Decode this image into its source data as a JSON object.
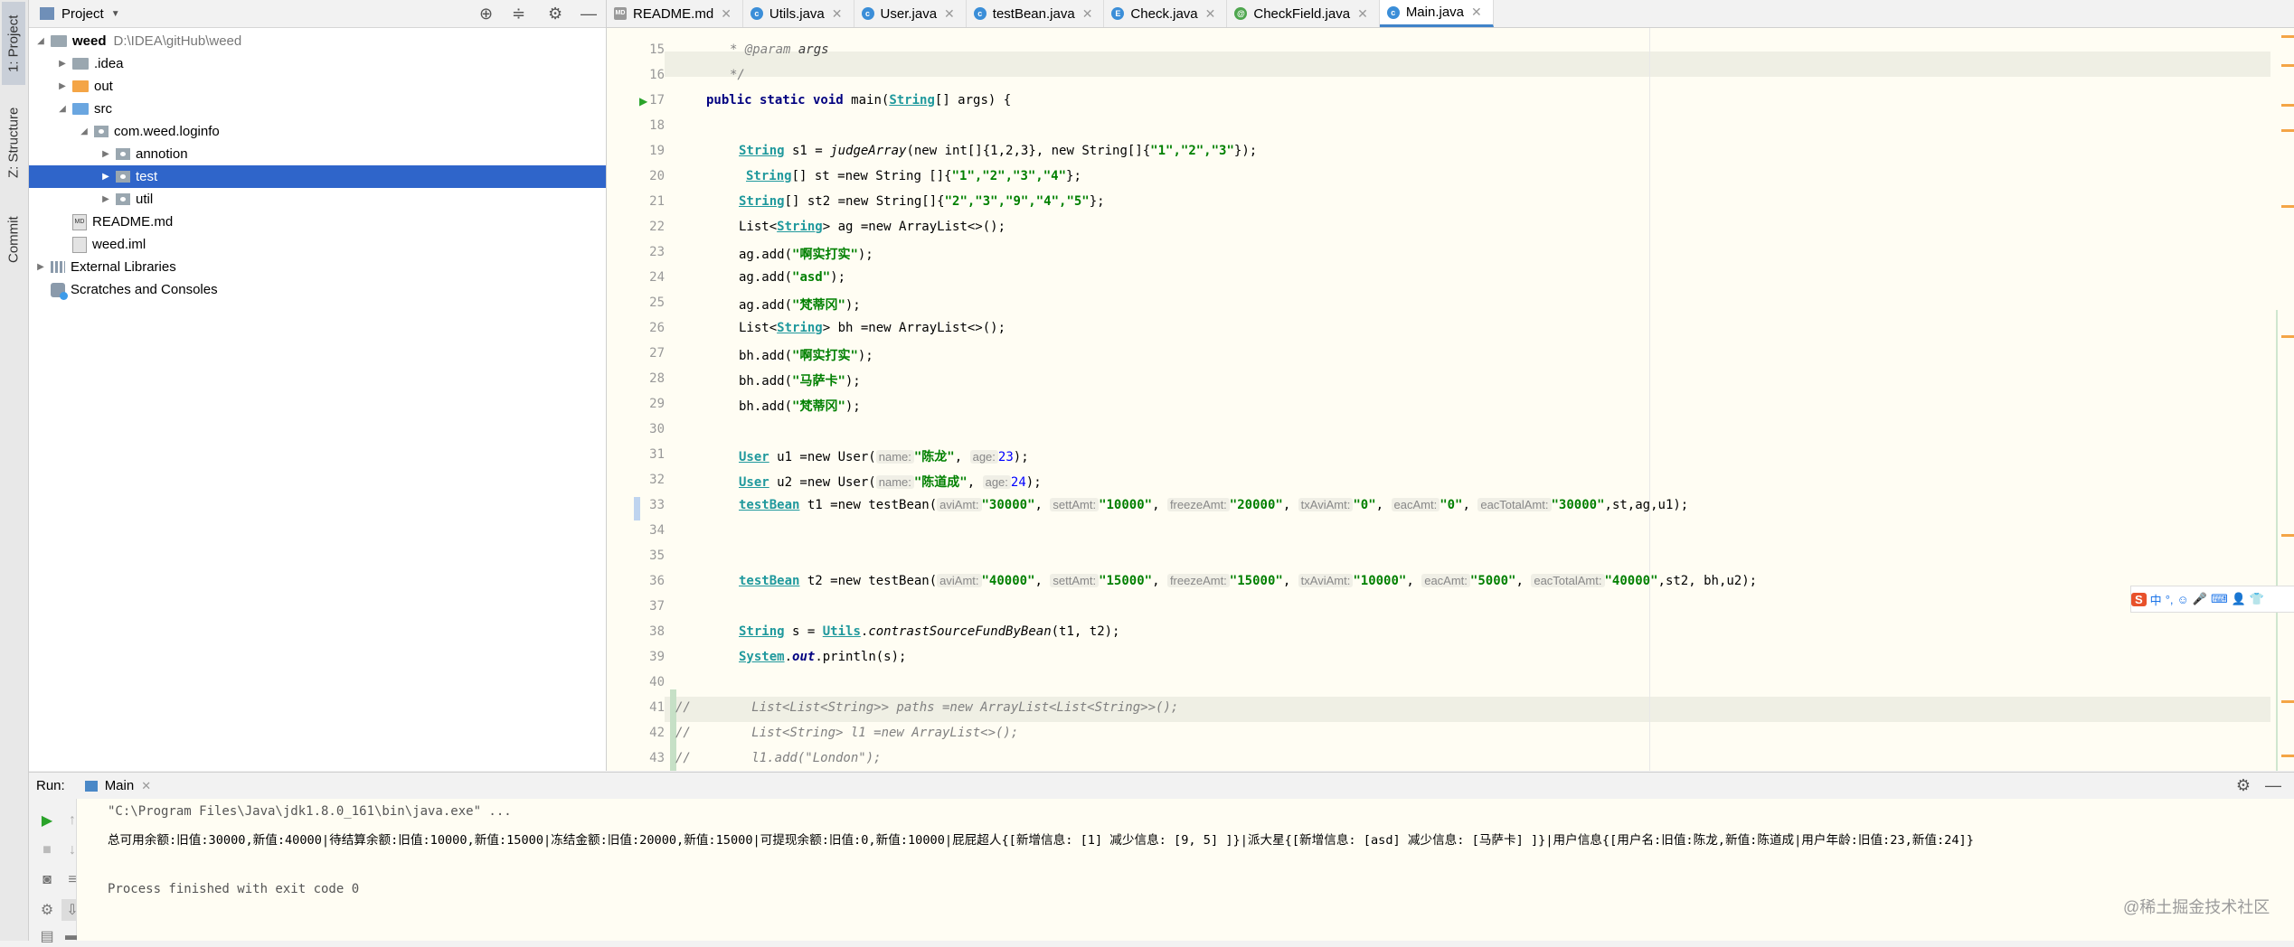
{
  "left_strip": {
    "project_tab": "1: Project",
    "structure_tab": "Z: Structure",
    "commit_tab": "Commit"
  },
  "project_panel": {
    "title": "Project",
    "tree": [
      {
        "label": "weed",
        "note": "D:\\IDEA\\gitHub\\weed"
      },
      {
        "label": ".idea"
      },
      {
        "label": "out"
      },
      {
        "label": "src"
      },
      {
        "label": "com.weed.loginfo"
      },
      {
        "label": "annotion"
      },
      {
        "label": "test"
      },
      {
        "label": "util"
      },
      {
        "label": "README.md"
      },
      {
        "label": "weed.iml"
      },
      {
        "label": "External Libraries"
      },
      {
        "label": "Scratches and Consoles"
      }
    ]
  },
  "tabs": [
    {
      "label": "README.md",
      "icon": "MD"
    },
    {
      "label": "Utils.java",
      "icon": "c"
    },
    {
      "label": "User.java",
      "icon": "c"
    },
    {
      "label": "testBean.java",
      "icon": "c"
    },
    {
      "label": "Check.java",
      "icon": "E"
    },
    {
      "label": "CheckField.java",
      "icon": "@"
    },
    {
      "label": "Main.java",
      "icon": "c"
    }
  ],
  "editor": {
    "line_numbers": [
      "15",
      "16",
      "17",
      "18",
      "19",
      "20",
      "21",
      "22",
      "23",
      "24",
      "25",
      "26",
      "27",
      "28",
      "29",
      "30",
      "31",
      "32",
      "33",
      "34",
      "35",
      "36",
      "37",
      "38",
      "39",
      "40",
      "41",
      "42",
      "43"
    ],
    "lines": {
      "l15_doctag": "* @param",
      "l15_param": "args",
      "l16": "*/",
      "l17_a": "public static void ",
      "l17_b": "main(",
      "l17_c": "String",
      "l17_d": "[] args) {",
      "l19_a": "String",
      "l19_b": " s1 = ",
      "l19_c": "judgeArray",
      "l19_d": "(new int[]{1,2,3}, new String[]{",
      "l19_e": "\"1\",\"2\",\"3\"",
      "l19_f": "});",
      "l20_a": "String",
      "l20_b": "[] st =new String []{",
      "l20_c": "\"1\",\"2\",\"3\",\"4\"",
      "l20_d": "};",
      "l21_a": "String",
      "l21_b": "[] st2 =new String[]{",
      "l21_c": "\"2\",\"3\",\"9\",\"4\",\"5\"",
      "l21_d": "};",
      "l22_a": "List<",
      "l22_b": "String",
      "l22_c": "> ag =new ArrayList<>();",
      "l23_a": "ag.add(",
      "l23_b": "\"啊实打实\"",
      "l23_c": ");",
      "l24_a": "ag.add(",
      "l24_b": "\"asd\"",
      "l24_c": ");",
      "l25_a": "ag.add(",
      "l25_b": "\"梵蒂冈\"",
      "l25_c": ");",
      "l26_a": "List<",
      "l26_b": "String",
      "l26_c": "> bh =new ArrayList<>();",
      "l27_a": "bh.add(",
      "l27_b": "\"啊实打实\"",
      "l27_c": ");",
      "l28_a": "bh.add(",
      "l28_b": "\"马萨卡\"",
      "l28_c": ");",
      "l29_a": "bh.add(",
      "l29_b": "\"梵蒂冈\"",
      "l29_c": ");",
      "l31_a": "User",
      "l31_b": " u1 =new User(",
      "l31_h1": "name:",
      "l31_s1": "\"陈龙\"",
      "l31_h2": "age:",
      "l31_n": "23",
      "l31_c": ");",
      "l32_a": "User",
      "l32_b": " u2 =new User(",
      "l32_h1": "name:",
      "l32_s1": "\"陈道成\"",
      "l32_h2": "age:",
      "l32_n": "24",
      "l32_c": ");",
      "l33_a": "testBean",
      "l33_b": " t1 =new testBean(",
      "l33_h1": "aviAmt:",
      "l33_s1": "\"30000\"",
      "l33_h2": "settAmt:",
      "l33_s2": "\"10000\"",
      "l33_h3": "freezeAmt:",
      "l33_s3": "\"20000\"",
      "l33_h4": "txAviAmt:",
      "l33_s4": "\"0\"",
      "l33_h5": "eacAmt:",
      "l33_s5": "\"0\"",
      "l33_h6": "eacTotalAmt:",
      "l33_s6": "\"30000\"",
      "l33_c": ",st,ag,u1);",
      "l36_a": "testBean",
      "l36_b": " t2 =new testBean(",
      "l36_h1": "aviAmt:",
      "l36_s1": "\"40000\"",
      "l36_h2": "settAmt:",
      "l36_s2": "\"15000\"",
      "l36_h3": "freezeAmt:",
      "l36_s3": "\"15000\"",
      "l36_h4": "txAviAmt:",
      "l36_s4": "\"10000\"",
      "l36_h5": "eacAmt:",
      "l36_s5": "\"5000\"",
      "l36_h6": "eacTotalAmt:",
      "l36_s6": "\"40000\"",
      "l36_c": ",st2, bh,u2);",
      "l38_a": "String",
      "l38_b": " s = ",
      "l38_c": "Utils",
      "l38_d": ".",
      "l38_e": "contrastSourceFundByBean",
      "l38_f": "(t1, t2);",
      "l39_a": "System",
      "l39_b": ".",
      "l39_c": "out",
      "l39_d": ".println(s);",
      "l41": "//        List<List<String>> paths =new ArrayList<List<String>>();",
      "l42": "//        List<String> l1 =new ArrayList<>();",
      "l43": "//        l1.add(\"London\");"
    }
  },
  "run": {
    "label": "Run:",
    "config": "Main",
    "cmd": "\"C:\\Program Files\\Java\\jdk1.8.0_161\\bin\\java.exe\" ...",
    "output": "总可用余额:旧值:30000,新值:40000|待结算余额:旧值:10000,新值:15000|冻结金额:旧值:20000,新值:15000|可提现余额:旧值:0,新值:10000|屁屁超人{[新增信息: [1] 减少信息: [9, 5] ]}|派大星{[新增信息: [asd] 减少信息: [马萨卡] ]}|用户信息{[用户名:旧值:陈龙,新值:陈道成|用户年龄:旧值:23,新值:24]}",
    "exit": "Process finished with exit code 0"
  },
  "ime": {
    "label": "中"
  },
  "watermark": "@稀土掘金技术社区"
}
